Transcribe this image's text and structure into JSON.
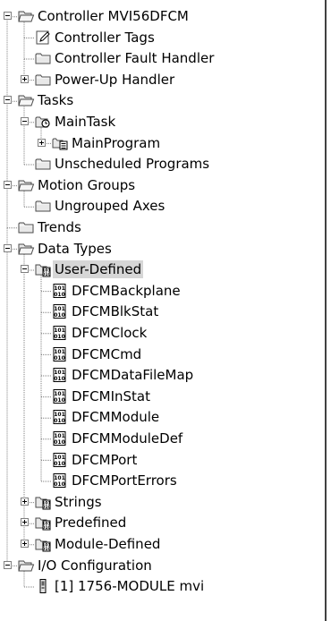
{
  "colors": {
    "connector": "#7f7f7f",
    "panel_border": "#404040",
    "selection": "#d6d6d6",
    "folder_fill": "#e8e8e8",
    "folder_stroke": "#4a4a4a"
  },
  "tree": [
    {
      "label": "Controller MVI56DFCM",
      "icon": "folder-open-icon",
      "expander": "minus",
      "level": 0
    },
    {
      "label": "Controller Tags",
      "icon": "controller-tags-icon",
      "expander": null,
      "level": 1
    },
    {
      "label": "Controller Fault Handler",
      "icon": "folder-icon",
      "expander": null,
      "level": 1
    },
    {
      "label": "Power-Up Handler",
      "icon": "folder-icon",
      "expander": "plus",
      "level": 1
    },
    {
      "label": "Tasks",
      "icon": "folder-open-icon",
      "expander": "minus",
      "level": 0
    },
    {
      "label": "MainTask",
      "icon": "task-icon",
      "expander": "minus",
      "level": 1
    },
    {
      "label": "MainProgram",
      "icon": "program-icon",
      "expander": "plus",
      "level": 2
    },
    {
      "label": "Unscheduled Programs",
      "icon": "folder-icon",
      "expander": null,
      "level": 1
    },
    {
      "label": "Motion Groups",
      "icon": "folder-open-icon",
      "expander": "minus",
      "level": 0
    },
    {
      "label": "Ungrouped Axes",
      "icon": "folder-icon",
      "expander": null,
      "level": 1
    },
    {
      "label": "Trends",
      "icon": "folder-icon",
      "expander": null,
      "level": 0
    },
    {
      "label": "Data Types",
      "icon": "folder-open-icon",
      "expander": "minus",
      "level": 0
    },
    {
      "label": "User-Defined",
      "icon": "datatype-folder-icon",
      "expander": "minus",
      "level": 1,
      "selected": true
    },
    {
      "label": "DFCMBackplane",
      "icon": "datatype-icon",
      "expander": null,
      "level": 2
    },
    {
      "label": "DFCMBlkStat",
      "icon": "datatype-icon",
      "expander": null,
      "level": 2
    },
    {
      "label": "DFCMClock",
      "icon": "datatype-icon",
      "expander": null,
      "level": 2
    },
    {
      "label": "DFCMCmd",
      "icon": "datatype-icon",
      "expander": null,
      "level": 2
    },
    {
      "label": "DFCMDataFileMap",
      "icon": "datatype-icon",
      "expander": null,
      "level": 2
    },
    {
      "label": "DFCMInStat",
      "icon": "datatype-icon",
      "expander": null,
      "level": 2
    },
    {
      "label": "DFCMModule",
      "icon": "datatype-icon",
      "expander": null,
      "level": 2
    },
    {
      "label": "DFCMModuleDef",
      "icon": "datatype-icon",
      "expander": null,
      "level": 2
    },
    {
      "label": "DFCMPort",
      "icon": "datatype-icon",
      "expander": null,
      "level": 2
    },
    {
      "label": "DFCMPortErrors",
      "icon": "datatype-icon",
      "expander": null,
      "level": 2
    },
    {
      "label": "Strings",
      "icon": "datatype-folder-icon",
      "expander": "plus",
      "level": 1
    },
    {
      "label": "Predefined",
      "icon": "datatype-folder-icon",
      "expander": "plus",
      "level": 1
    },
    {
      "label": "Module-Defined",
      "icon": "datatype-folder-icon",
      "expander": "plus",
      "level": 1
    },
    {
      "label": "I/O Configuration",
      "icon": "folder-open-icon",
      "expander": "minus",
      "level": 0
    },
    {
      "label": "[1] 1756-MODULE mvi",
      "icon": "module-icon",
      "expander": null,
      "level": 1
    }
  ]
}
